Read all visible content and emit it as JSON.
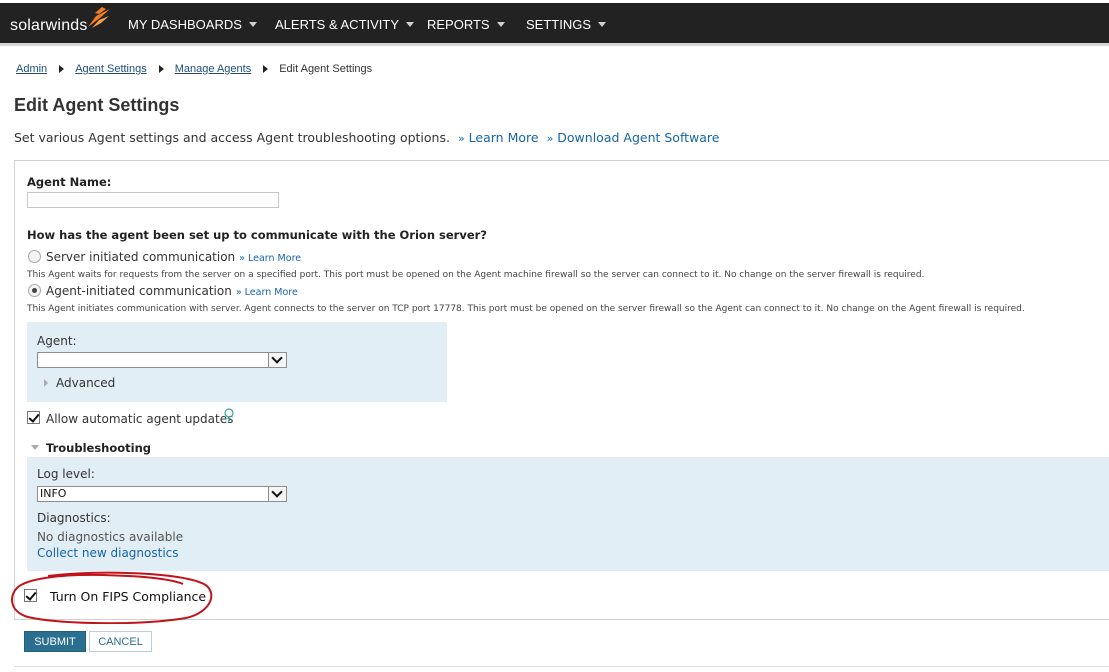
{
  "header": {
    "logo_text": "solarwinds",
    "nav": [
      {
        "label": "MY DASHBOARDS"
      },
      {
        "label": "ALERTS & ACTIVITY"
      },
      {
        "label": "REPORTS"
      },
      {
        "label": "SETTINGS"
      }
    ]
  },
  "breadcrumb": {
    "items": [
      "Admin",
      "Agent Settings",
      "Manage Agents"
    ],
    "current": "Edit Agent Settings"
  },
  "page": {
    "title": "Edit Agent Settings",
    "subtitle": "Set various Agent settings and access Agent troubleshooting options.",
    "learn_more": "Learn More",
    "download": "Download Agent Software",
    "raquo": "»"
  },
  "form": {
    "agent_name_label": "Agent Name:",
    "agent_name_value": "",
    "comm_question": "How has the agent been set up to communicate with the Orion server?",
    "server_initiated": {
      "label": "Server initiated communication",
      "link": "» Learn More",
      "help": "This Agent waits for requests from the server on a specified port. This port must be opened on the Agent machine firewall so the server can connect to it. No change on the server firewall is required.",
      "selected": false
    },
    "agent_initiated": {
      "label": "Agent-initiated communication",
      "link": "» Learn More",
      "help": "This Agent initiates communication with server. Agent connects to the server on TCP port 17778. This port must be opened on the server firewall so the Agent can connect to it. No change on the Agent firewall is required.",
      "selected": true
    },
    "agent_label": "Agent:",
    "agent_select_value": "",
    "advanced_label": "Advanced",
    "auto_updates_label": "Allow automatic agent updates",
    "auto_updates_checked": true,
    "troubleshooting_label": "Troubleshooting",
    "log_level_label": "Log level:",
    "log_level_value": "INFO",
    "diagnostics_label": "Diagnostics:",
    "no_diagnostics": "No diagnostics available",
    "collect_diagnostics": "Collect new diagnostics",
    "fips_label": "Turn On FIPS Compliance",
    "fips_checked": true
  },
  "buttons": {
    "submit": "SUBMIT",
    "cancel": "CANCEL"
  },
  "colors": {
    "topbar": "#222222",
    "link": "#1565a8",
    "panel_blue": "#e2eef6",
    "submit": "#2a6f8f",
    "annotation": "#c0141c"
  }
}
